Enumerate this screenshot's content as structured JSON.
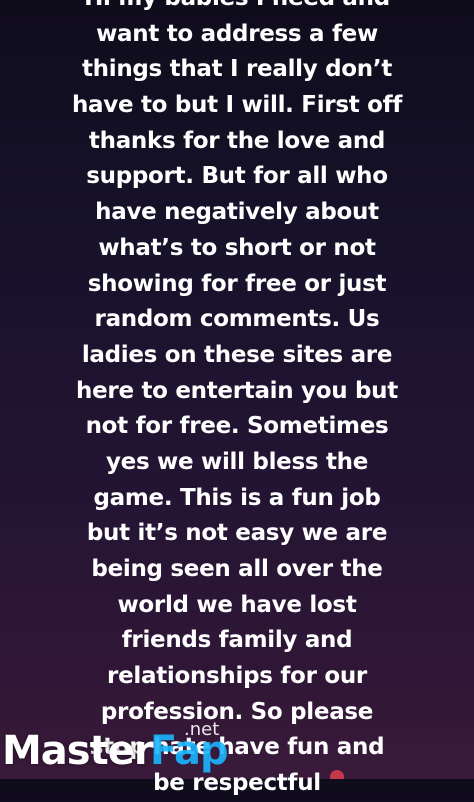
{
  "story": {
    "lines": [
      "Hi my babies I need and",
      "want to address a few",
      "things that I really don’t",
      "have to but I will. First off",
      "thanks for the love and",
      "support. But for all who",
      "have negatively about",
      "what’s to short or not",
      "showing for free or just",
      "random comments. Us",
      "ladies on these sites are",
      "here to entertain you but",
      "not for free. Sometimes",
      "yes we will bless the",
      "game. This is a fun job",
      "but it’s not easy we are",
      "being seen all over the",
      "world we have lost",
      "friends family and",
      "relationships for our",
      "profession. So please",
      "stop hate have fun and",
      "be respectful"
    ]
  },
  "watermark": {
    "word_master": "Master",
    "word_fap": "Fap",
    "tld": ".net",
    "fap_color": "#19b6ff"
  },
  "icons": {
    "trailing_emoji": "heart-emoji-icon"
  }
}
